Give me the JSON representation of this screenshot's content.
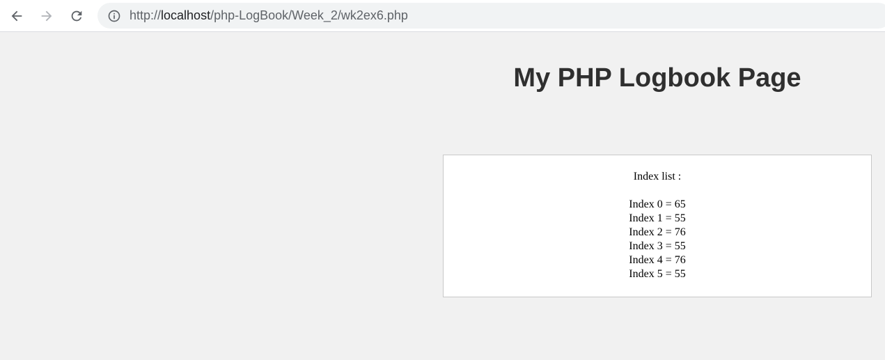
{
  "browser": {
    "url_prefix": "http://",
    "url_host": "localhost",
    "url_path": "/php-LogBook/Week_2/wk2ex6.php",
    "icons": {
      "back": "back-arrow-icon",
      "forward": "forward-arrow-icon",
      "reload": "reload-icon",
      "info": "info-icon"
    }
  },
  "page": {
    "title": "My PHP Logbook Page",
    "list_heading": "Index list :",
    "items": [
      "Index 0 = 65",
      "Index 1 = 55",
      "Index 2 = 76",
      "Index 3 = 55",
      "Index 4 = 76",
      "Index 5 = 55"
    ]
  },
  "colors": {
    "page_background": "#f1f1f1",
    "title_text": "#2f2f2f",
    "box_border": "#c8c8c8"
  }
}
